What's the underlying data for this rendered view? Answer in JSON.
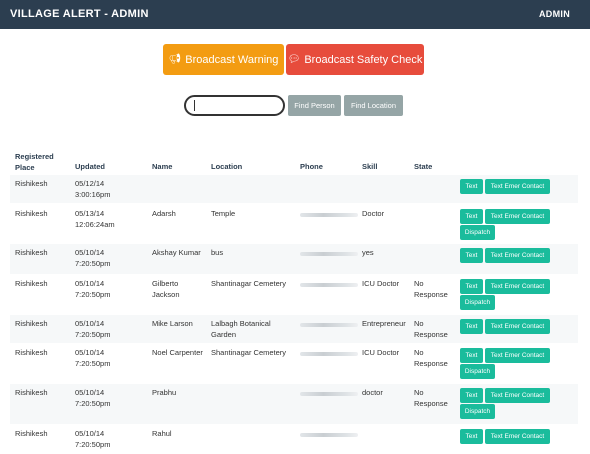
{
  "navbar": {
    "brand": "VILLAGE ALERT - ADMIN",
    "user": "ADMIN"
  },
  "actions": {
    "broadcast_warning": "Broadcast Warning",
    "broadcast_safety": "Broadcast Safety Check",
    "warning_icon": "bullhorn-icon",
    "safety_icon": "comment-icon"
  },
  "search": {
    "value": "",
    "find_person": "Find Person",
    "find_location": "Find Location"
  },
  "colors": {
    "navbar": "#2c3e50",
    "warning": "#f39c12",
    "danger": "#e74c3c",
    "action": "#1abc9c",
    "find": "#95a5a6"
  },
  "table": {
    "headers": {
      "place": "Registered Place",
      "updated": "Updated",
      "name": "Name",
      "location": "Location",
      "phone": "Phone",
      "skill": "Skill",
      "state": "State"
    },
    "action_labels": {
      "text": "Text",
      "emer": "Text Emer Contact",
      "dispatch": "Dispatch"
    },
    "rows": [
      {
        "place": "Rishikesh",
        "updated": "05/12/14 3:00:16pm",
        "name": "",
        "location": "",
        "skill": "",
        "state": "",
        "dispatch": false
      },
      {
        "place": "Rishikesh",
        "updated": "05/13/14 12:06:24am",
        "name": "Adarsh",
        "location": "Temple",
        "skill": "Doctor",
        "state": "",
        "dispatch": true
      },
      {
        "place": "Rishikesh",
        "updated": "05/10/14 7:20:50pm",
        "name": "Akshay Kumar",
        "location": "bus",
        "skill": "yes",
        "state": "",
        "dispatch": false
      },
      {
        "place": "Rishikesh",
        "updated": "05/10/14 7:20:50pm",
        "name": "Gilberto Jackson",
        "location": "Shantinagar Cemetery",
        "skill": "ICU Doctor",
        "state": "No Response",
        "dispatch": true
      },
      {
        "place": "Rishikesh",
        "updated": "05/10/14 7:20:50pm",
        "name": "Mike Larson",
        "location": "Lalbagh Botanical Garden",
        "skill": "Entrepreneur",
        "state": "No Response",
        "dispatch": false
      },
      {
        "place": "Rishikesh",
        "updated": "05/10/14 7:20:50pm",
        "name": "Noel Carpenter",
        "location": "Shantinagar Cemetery",
        "skill": "ICU Doctor",
        "state": "No Response",
        "dispatch": true
      },
      {
        "place": "Rishikesh",
        "updated": "05/10/14 7:20:50pm",
        "name": "Prabhu",
        "location": "",
        "skill": "doctor",
        "state": "No Response",
        "dispatch": true
      },
      {
        "place": "Rishikesh",
        "updated": "05/10/14 7:20:50pm",
        "name": "Rahul",
        "location": "",
        "skill": "",
        "state": "",
        "dispatch": false
      }
    ]
  }
}
